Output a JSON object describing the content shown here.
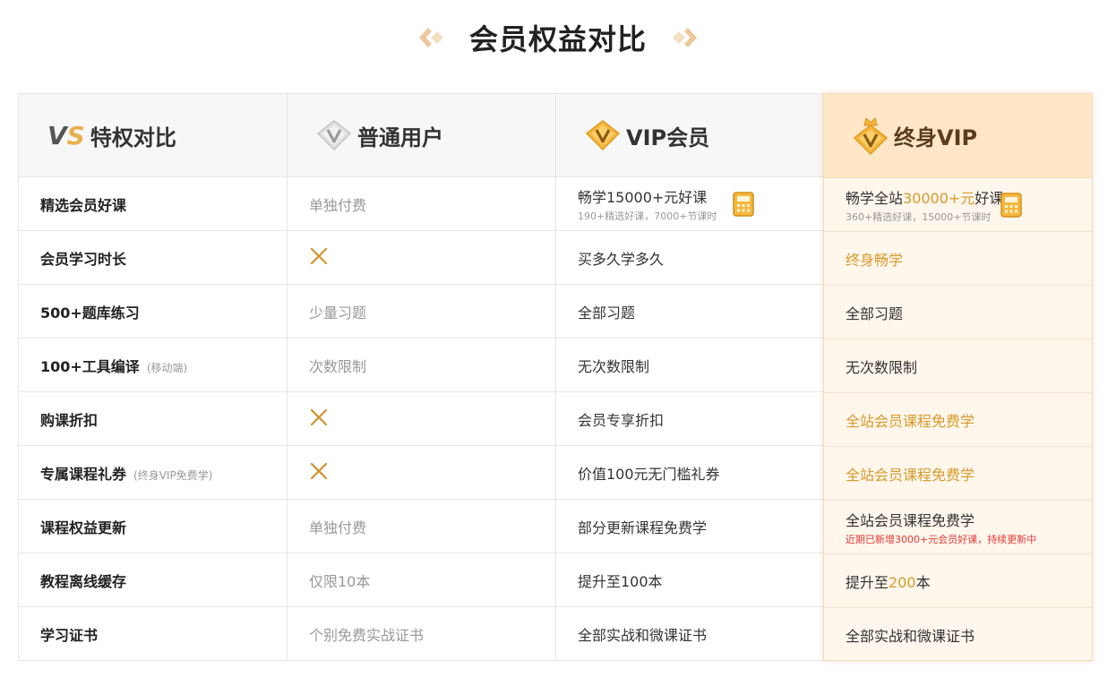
{
  "page_title": "会员权益对比",
  "columns": {
    "features": {
      "label": "特权对比",
      "vs_v": "V",
      "vs_s": "S"
    },
    "normal": {
      "label": "普通用户"
    },
    "vip": {
      "label": "VIP会员"
    },
    "lifetime": {
      "label": "终身VIP"
    }
  },
  "rows": [
    {
      "feature": "精选会员好课",
      "note": "",
      "normal": "单独付费",
      "vip": "畅学15000+元好课",
      "vip_sub": "190+精选好课，7000+节课时",
      "life_pre": "畅学全站",
      "life_highlight": "30000+元",
      "life_post": "好课",
      "life_sub": "360+精选好课，15000+节课时"
    },
    {
      "feature": "会员学习时长",
      "note": "",
      "normal": "",
      "vip": "买多久学多久",
      "life": "终身畅学"
    },
    {
      "feature": "500+题库练习",
      "note": "",
      "normal": "少量习题",
      "vip": "全部习题",
      "life": "全部习题"
    },
    {
      "feature": "100+工具编译",
      "note": "(移动端)",
      "normal": "次数限制",
      "vip": "无次数限制",
      "life": "无次数限制"
    },
    {
      "feature": "购课折扣",
      "note": "",
      "normal": "",
      "vip": "会员专享折扣",
      "life": "全站会员课程免费学"
    },
    {
      "feature": "专属课程礼券",
      "note": "(终身VIP免费学)",
      "normal": "",
      "vip": "价值100元无门槛礼券",
      "life": "全站会员课程免费学"
    },
    {
      "feature": "课程权益更新",
      "note": "",
      "normal": "单独付费",
      "vip": "部分更新课程免费学",
      "life": "全站会员课程免费学",
      "life_sub": "近期已新增3000+元会员好课，持续更新中"
    },
    {
      "feature": "教程离线缓存",
      "note": "",
      "normal": "仅限10本",
      "vip": "提升至100本",
      "life_pre": "提升至",
      "life_highlight": "200",
      "life_post": "本"
    },
    {
      "feature": "学习证书",
      "note": "",
      "normal": "个别免费实战证书",
      "vip": "全部实战和微课证书",
      "life": "全部实战和微课证书"
    }
  ],
  "colors": {
    "gold": "#d89a2a",
    "highlight_bg": "#fff6ec",
    "header_bg": "#ffe6c6",
    "red": "#e53935"
  }
}
